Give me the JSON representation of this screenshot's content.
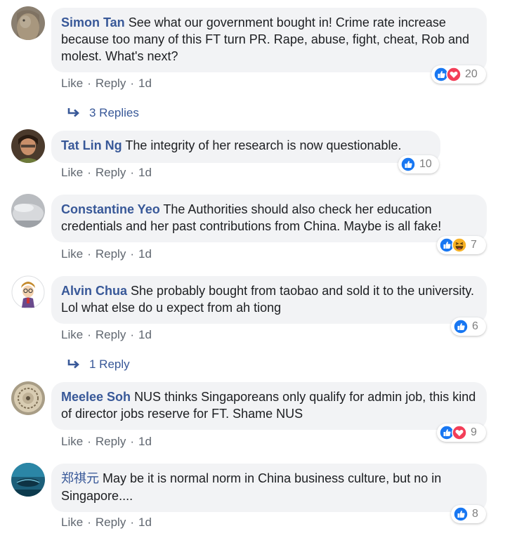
{
  "colors": {
    "author": "#385898",
    "bubble": "#f2f3f5",
    "like_blue": "#1877f2",
    "love_red": "#f33e58",
    "haha_yellow": "#f7b125"
  },
  "comments": [
    {
      "author": "Simon Tan",
      "text": "See what our government bought in! Crime rate increase because too many of this FT turn PR. Rape, abuse, fight, cheat, Rob and molest. What's next?",
      "actions": {
        "like": "Like",
        "reply": "Reply",
        "time": "1d"
      },
      "reactions": [
        "like-icon",
        "love-icon"
      ],
      "reaction_count": "20",
      "replies": "3 Replies"
    },
    {
      "author": "Tat Lin Ng",
      "text": "The integrity of her research is now questionable.",
      "actions": {
        "like": "Like",
        "reply": "Reply",
        "time": "1d"
      },
      "reactions": [
        "like-icon"
      ],
      "reaction_count": "10"
    },
    {
      "author": "Constantine Yeo",
      "text": "The Authorities should also check her education credentials and her past contributions from China. Maybe is all fake!",
      "actions": {
        "like": "Like",
        "reply": "Reply",
        "time": "1d"
      },
      "reactions": [
        "like-icon",
        "haha-icon"
      ],
      "reaction_count": "7"
    },
    {
      "author": "Alvin Chua",
      "text": "She probably bought from taobao and sold it to the university. Lol what else do u expect from ah tiong",
      "actions": {
        "like": "Like",
        "reply": "Reply",
        "time": "1d"
      },
      "reactions": [
        "like-icon"
      ],
      "reaction_count": "6",
      "replies": "1 Reply"
    },
    {
      "author": "Meelee Soh",
      "text": "NUS thinks Singaporeans only qualify for admin job, this kind of director jobs reserve for FT. Shame NUS",
      "actions": {
        "like": "Like",
        "reply": "Reply",
        "time": "1d"
      },
      "reactions": [
        "like-icon",
        "love-icon"
      ],
      "reaction_count": "9"
    },
    {
      "author": "郑祺元",
      "text": "May be it is normal norm in China business culture, but no in Singapore....",
      "actions": {
        "like": "Like",
        "reply": "Reply",
        "time": "1d"
      },
      "reactions": [
        "like-icon"
      ],
      "reaction_count": "8"
    }
  ]
}
